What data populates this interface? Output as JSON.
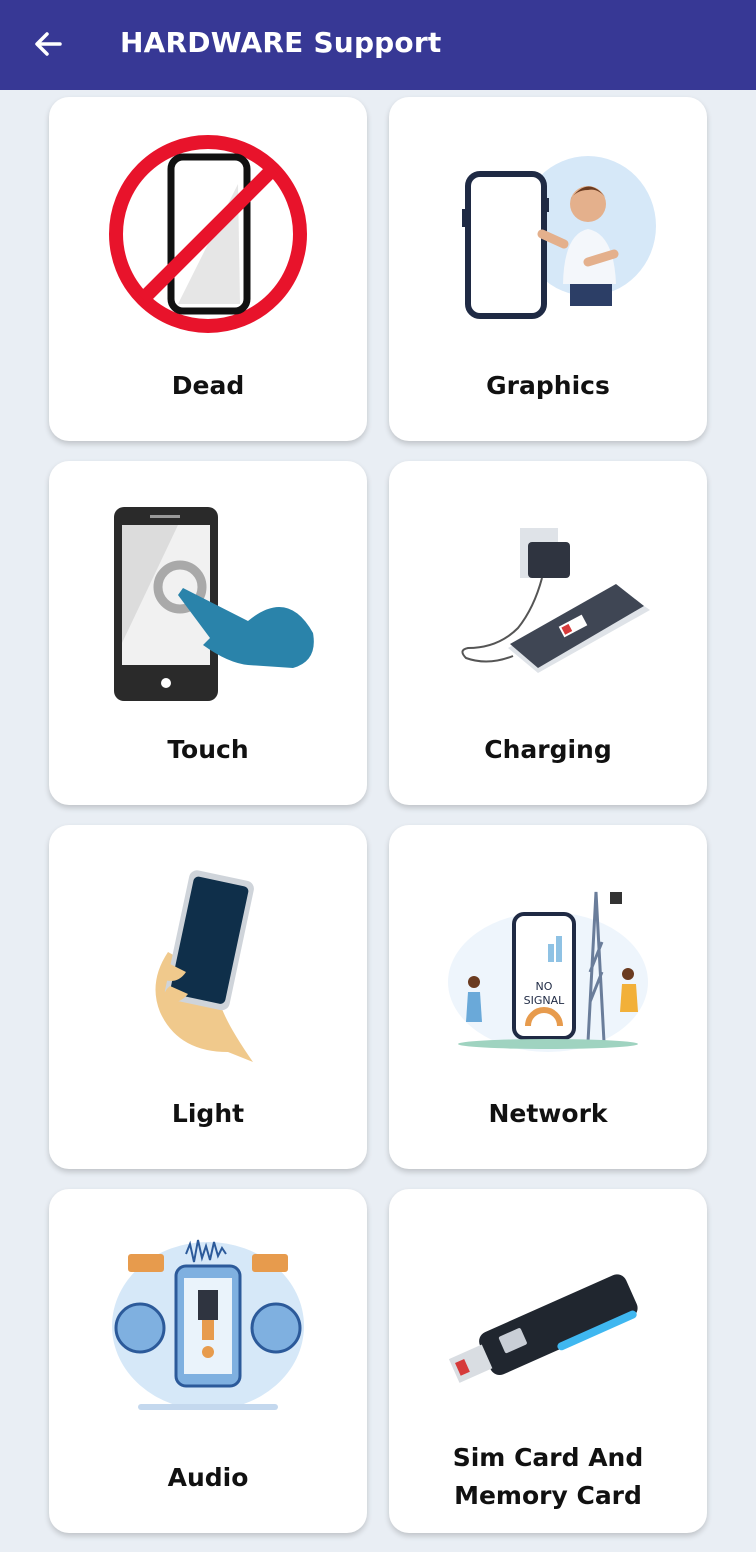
{
  "header": {
    "title": "HARDWARE Support",
    "background": "#373895"
  },
  "cards": [
    {
      "label": "Dead",
      "icon": "dead-phone-icon"
    },
    {
      "label": "Graphics",
      "icon": "graphics-icon"
    },
    {
      "label": "Touch",
      "icon": "touch-icon"
    },
    {
      "label": "Charging",
      "icon": "charging-icon"
    },
    {
      "label": "Light",
      "icon": "light-icon"
    },
    {
      "label": "Network",
      "icon": "network-icon"
    },
    {
      "label": "Audio",
      "icon": "audio-icon"
    },
    {
      "label": "Sim Card And Memory Card",
      "icon": "sim-memory-card-icon"
    }
  ],
  "network_art": {
    "text1": "NO",
    "text2": "SIGNAL"
  }
}
